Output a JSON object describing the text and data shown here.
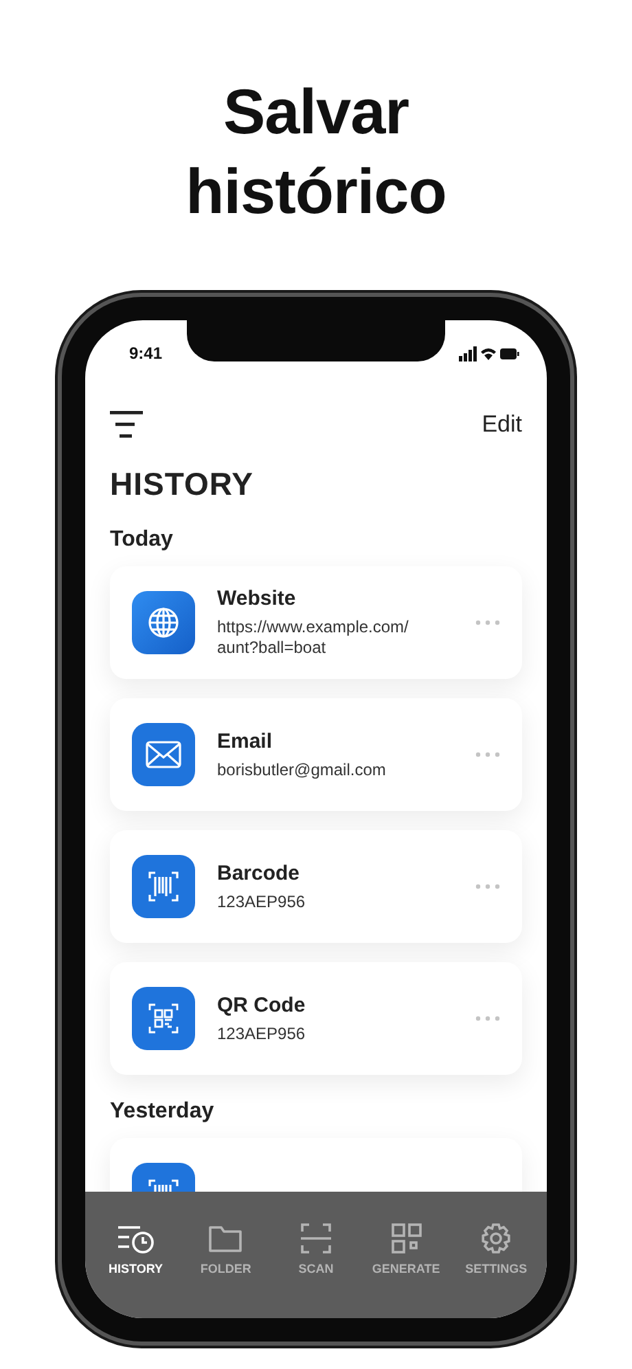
{
  "headline": "Salvar histórico",
  "status_bar": {
    "time": "9:41"
  },
  "header": {
    "edit": "Edit",
    "title": "HISTORY"
  },
  "sections": [
    {
      "label": "Today",
      "items": [
        {
          "kind": "website",
          "title": "Website",
          "detail": "https://www.example.com/\naunt?ball=boat"
        },
        {
          "kind": "email",
          "title": "Email",
          "detail": "borisbutler@gmail.com"
        },
        {
          "kind": "barcode",
          "title": "Barcode",
          "detail": "123AEP956"
        },
        {
          "kind": "qr",
          "title": "QR Code",
          "detail": "123AEP956"
        }
      ]
    },
    {
      "label": "Yesterday",
      "items": [
        {
          "kind": "barcode"
        }
      ]
    }
  ],
  "tabs": [
    {
      "kind": "history",
      "label": "HISTORY",
      "selected": true
    },
    {
      "kind": "folder",
      "label": "FOLDER",
      "selected": false
    },
    {
      "kind": "scan",
      "label": "SCAN",
      "selected": false
    },
    {
      "kind": "generate",
      "label": "GENERATE",
      "selected": false
    },
    {
      "kind": "settings",
      "label": "SETTINGS",
      "selected": false
    }
  ]
}
